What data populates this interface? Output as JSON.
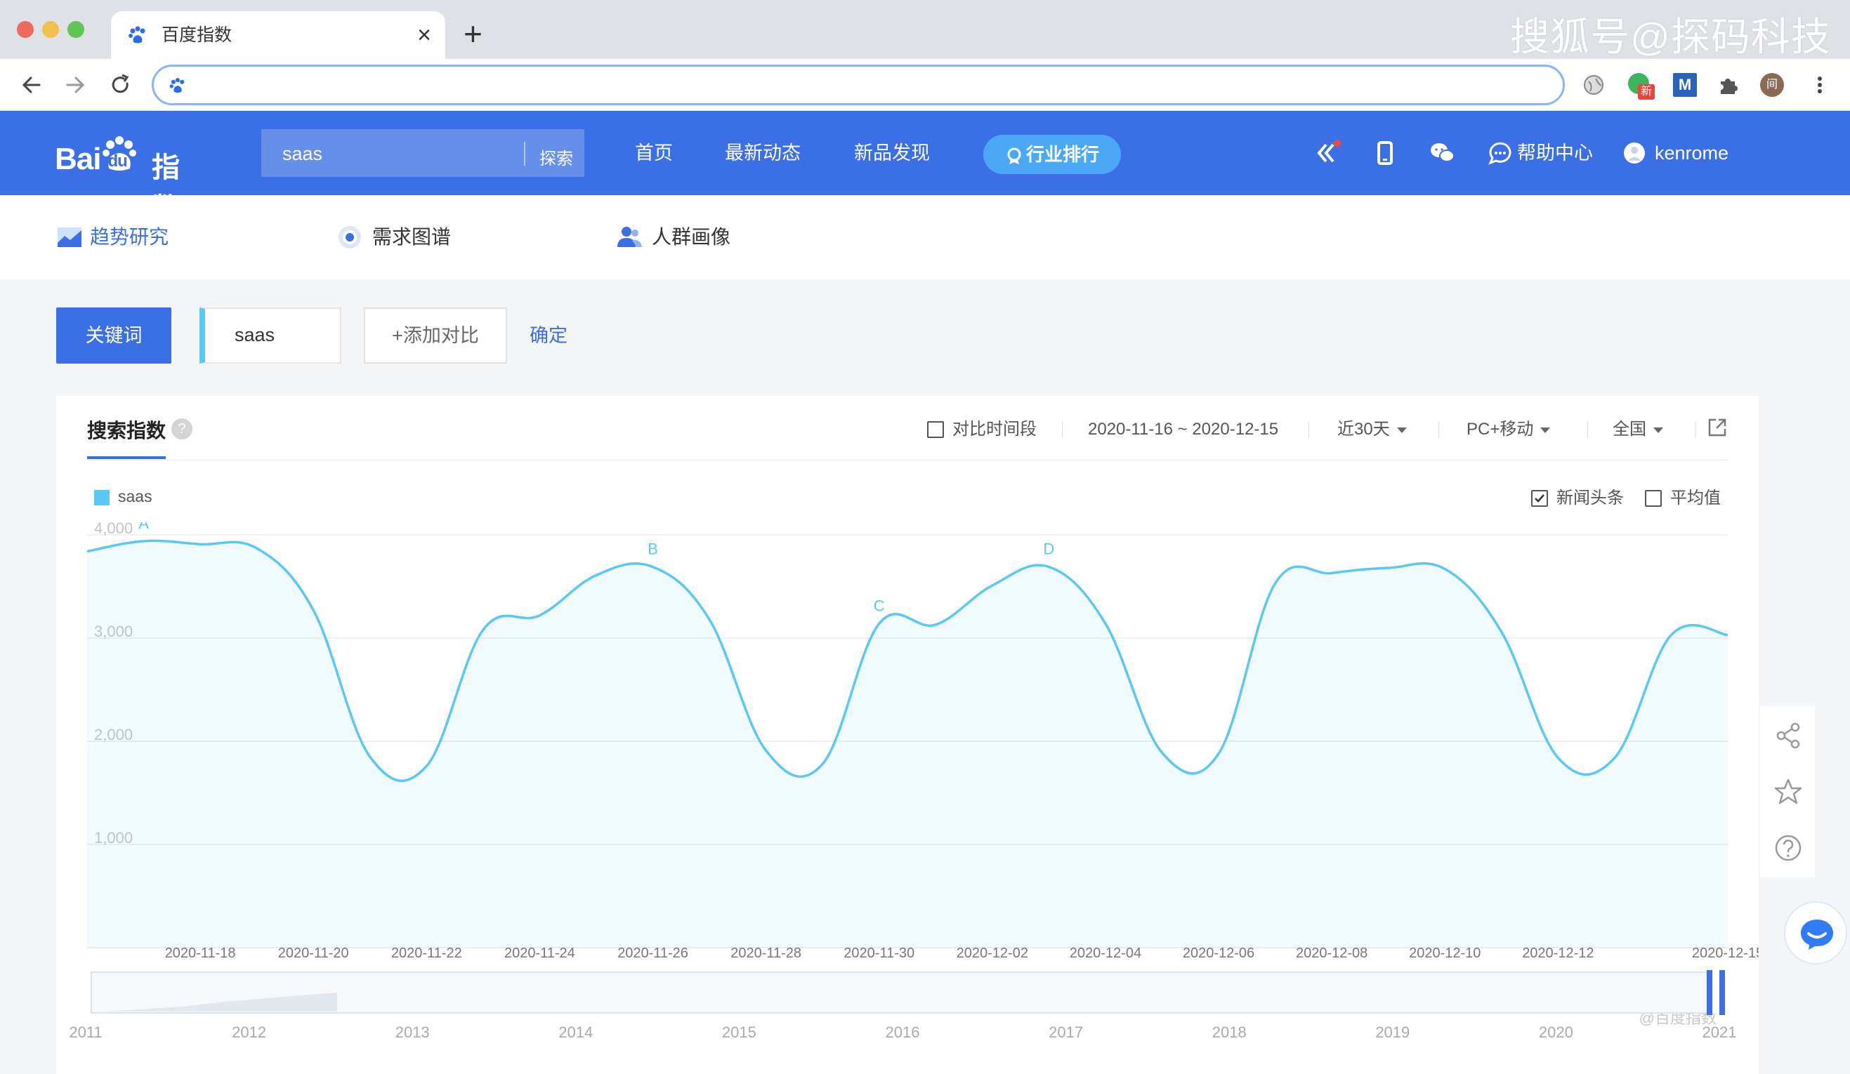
{
  "browser": {
    "tab_title": "百度指数",
    "close_glyph": "×",
    "new_tab_glyph": "+",
    "watermark": "搜狐号@探码科技",
    "address_url": "",
    "ext_badge": "新",
    "ext_m": "M",
    "profile_initial": "间"
  },
  "header": {
    "logo_text": "Bai",
    "logo_du": "du",
    "logo_cn": "指数",
    "search_value": "saas",
    "search_button": "探索",
    "nav": [
      "首页",
      "最新动态",
      "新品发现"
    ],
    "rank_button": "行业排行",
    "help": "帮助中心",
    "user": "kenrome"
  },
  "subnav": {
    "items": [
      "趋势研究",
      "需求图谱",
      "人群画像"
    ],
    "active": "趋势研究"
  },
  "keyword_row": {
    "label": "关键词",
    "keyword": "saas",
    "add_compare": "+添加对比",
    "confirm": "确定"
  },
  "card": {
    "title": "搜索指数",
    "help": "?",
    "compare_period": "对比时间段",
    "date_range": "2020-11-16 ~ 2020-12-15",
    "period": "近30天",
    "device": "PC+移动",
    "region": "全国",
    "legend": "saas",
    "news_checkbox": "新闻头条",
    "news_checked": true,
    "avg_checkbox": "平均值",
    "avg_checked": false,
    "credit": "@百度指数"
  },
  "chart_data": {
    "type": "area",
    "color": "#5ac8f5",
    "ylim": [
      0,
      4000
    ],
    "yticks": [
      "4,000",
      "3,000",
      "2,000",
      "1,000"
    ],
    "x": [
      "2020-11-16",
      "2020-11-17",
      "2020-11-18",
      "2020-11-19",
      "2020-11-20",
      "2020-11-21",
      "2020-11-22",
      "2020-11-23",
      "2020-11-24",
      "2020-11-25",
      "2020-11-26",
      "2020-11-27",
      "2020-11-28",
      "2020-11-29",
      "2020-11-30",
      "2020-12-01",
      "2020-12-02",
      "2020-12-03",
      "2020-12-04",
      "2020-12-05",
      "2020-12-06",
      "2020-12-07",
      "2020-12-08",
      "2020-12-09",
      "2020-12-10",
      "2020-12-11",
      "2020-12-12",
      "2020-12-13",
      "2020-12-14",
      "2020-12-15"
    ],
    "series": [
      {
        "name": "saas",
        "values": [
          3840,
          3940,
          3910,
          3870,
          3270,
          1850,
          1760,
          3080,
          3220,
          3610,
          3690,
          3180,
          1910,
          1780,
          3140,
          3130,
          3510,
          3690,
          3140,
          1890,
          1880,
          3530,
          3630,
          3680,
          3670,
          3060,
          1840,
          1840,
          3030,
          3030
        ]
      }
    ],
    "xticks": [
      "2020-11-18",
      "2020-11-20",
      "2020-11-22",
      "2020-11-24",
      "2020-11-26",
      "2020-11-28",
      "2020-11-30",
      "2020-12-02",
      "2020-12-04",
      "2020-12-06",
      "2020-12-08",
      "2020-12-10",
      "2020-12-12",
      "2020-12-15"
    ],
    "annotations": [
      {
        "label": "A",
        "x": "2020-11-17"
      },
      {
        "label": "B",
        "x": "2020-11-26"
      },
      {
        "label": "C",
        "x": "2020-11-30"
      },
      {
        "label": "D",
        "x": "2020-12-03"
      }
    ],
    "overview_years": [
      "2011",
      "2012",
      "2013",
      "2014",
      "2015",
      "2016",
      "2017",
      "2018",
      "2019",
      "2020",
      "2021"
    ]
  }
}
